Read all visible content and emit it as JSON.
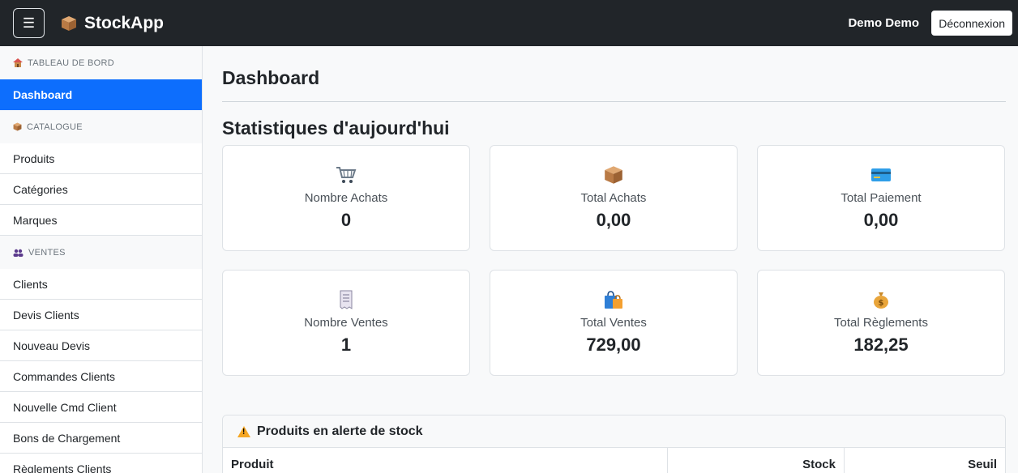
{
  "header": {
    "brand": "StockApp",
    "brand_icon": "package-icon",
    "menu_icon": "☰",
    "user_name": "Demo Demo",
    "logout_label": "Déconnexion"
  },
  "sidebar": {
    "sections": [
      {
        "heading": "TABLEAU DE BORD",
        "icon": "house-icon",
        "items": [
          {
            "label": "Dashboard",
            "active": true
          }
        ]
      },
      {
        "heading": "CATALOGUE",
        "icon": "package-icon",
        "items": [
          {
            "label": "Produits"
          },
          {
            "label": "Catégories"
          },
          {
            "label": "Marques"
          }
        ]
      },
      {
        "heading": "VENTES",
        "icon": "people-icon",
        "items": [
          {
            "label": "Clients"
          },
          {
            "label": "Devis Clients"
          },
          {
            "label": "Nouveau Devis"
          },
          {
            "label": "Commandes Clients"
          },
          {
            "label": "Nouvelle Cmd Client"
          },
          {
            "label": "Bons de Chargement"
          },
          {
            "label": "Règlements Clients"
          }
        ]
      }
    ]
  },
  "main": {
    "page_title": "Dashboard",
    "stats_title": "Statistiques d'aujourd'hui",
    "cards": [
      {
        "label": "Nombre Achats",
        "value": "0",
        "icon": "shopping-cart-icon"
      },
      {
        "label": "Total Achats",
        "value": "0,00",
        "icon": "package-icon"
      },
      {
        "label": "Total Paiement",
        "value": "0,00",
        "icon": "credit-card-icon"
      },
      {
        "label": "Nombre Ventes",
        "value": "1",
        "icon": "receipt-icon"
      },
      {
        "label": "Total Ventes",
        "value": "729,00",
        "icon": "shopping-bags-icon"
      },
      {
        "label": "Total Règlements",
        "value": "182,25",
        "icon": "money-bag-icon"
      }
    ],
    "alert": {
      "title": "Produits en alerte de stock",
      "icon": "warning-icon",
      "columns": [
        "Produit",
        "Stock",
        "Seuil"
      ]
    }
  },
  "colors": {
    "topbar": "#212529",
    "active": "#0d6efd"
  }
}
